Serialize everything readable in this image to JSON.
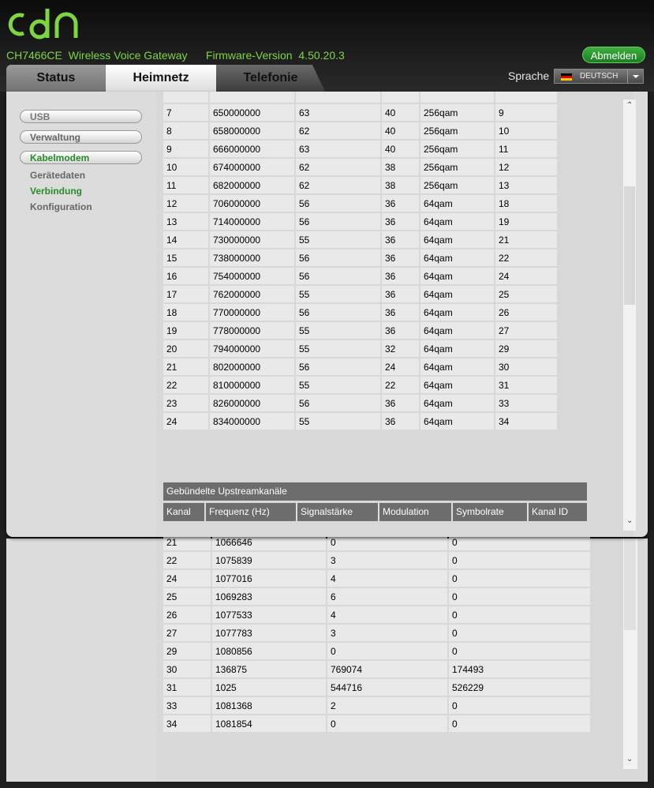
{
  "header": {
    "model": "CH7466CE",
    "device_name": "Wireless Voice Gateway",
    "firmware_label": "Firmware-Version",
    "firmware_version": "4.50.20.3",
    "logout_label": "Abmelden",
    "language_label": "Sprache",
    "language_value": "DEUTSCH"
  },
  "tabs": [
    {
      "label": "Status"
    },
    {
      "label": "Heimnetz"
    },
    {
      "label": "Telefonie"
    }
  ],
  "sidebar": {
    "buttons": [
      {
        "label": "USB"
      },
      {
        "label": "Verwaltung"
      },
      {
        "label": "Kabelmodem"
      }
    ],
    "subitems": [
      {
        "label": "Gerätedaten"
      },
      {
        "label": "Verbindung"
      },
      {
        "label": "Konfiguration"
      }
    ]
  },
  "downstream_rows": [
    [
      "7",
      "650000000",
      "63",
      "40",
      "256qam",
      "9"
    ],
    [
      "8",
      "658000000",
      "62",
      "40",
      "256qam",
      "10"
    ],
    [
      "9",
      "666000000",
      "63",
      "40",
      "256qam",
      "11"
    ],
    [
      "10",
      "674000000",
      "62",
      "38",
      "256qam",
      "12"
    ],
    [
      "11",
      "682000000",
      "62",
      "38",
      "256qam",
      "13"
    ],
    [
      "12",
      "706000000",
      "56",
      "36",
      "64qam",
      "18"
    ],
    [
      "13",
      "714000000",
      "56",
      "36",
      "64qam",
      "19"
    ],
    [
      "14",
      "730000000",
      "55",
      "36",
      "64qam",
      "21"
    ],
    [
      "15",
      "738000000",
      "56",
      "36",
      "64qam",
      "22"
    ],
    [
      "16",
      "754000000",
      "56",
      "36",
      "64qam",
      "24"
    ],
    [
      "17",
      "762000000",
      "55",
      "36",
      "64qam",
      "25"
    ],
    [
      "18",
      "770000000",
      "56",
      "36",
      "64qam",
      "26"
    ],
    [
      "19",
      "778000000",
      "55",
      "36",
      "64qam",
      "27"
    ],
    [
      "20",
      "794000000",
      "55",
      "32",
      "64qam",
      "29"
    ],
    [
      "21",
      "802000000",
      "56",
      "24",
      "64qam",
      "30"
    ],
    [
      "22",
      "810000000",
      "55",
      "22",
      "64qam",
      "31"
    ],
    [
      "23",
      "826000000",
      "56",
      "36",
      "64qam",
      "33"
    ],
    [
      "24",
      "834000000",
      "55",
      "36",
      "64qam",
      "34"
    ]
  ],
  "upstream": {
    "title": "Gebündelte Upstreamkanäle",
    "headers": [
      "Kanal",
      "Frequenz (Hz)",
      "Signalstärke",
      "Modulation",
      "Symbolrate",
      "Kanal ID"
    ]
  },
  "lower_rows": [
    [
      "21",
      "1066646",
      "0",
      "0"
    ],
    [
      "22",
      "1075839",
      "3",
      "0"
    ],
    [
      "24",
      "1077016",
      "4",
      "0"
    ],
    [
      "25",
      "1069283",
      "6",
      "0"
    ],
    [
      "26",
      "1077533",
      "4",
      "0"
    ],
    [
      "27",
      "1077783",
      "3",
      "0"
    ],
    [
      "29",
      "1080856",
      "0",
      "0"
    ],
    [
      "30",
      "136875",
      "769074",
      "174493"
    ],
    [
      "31",
      "1025",
      "544716",
      "526229"
    ],
    [
      "33",
      "1081368",
      "2",
      "0"
    ],
    [
      "34",
      "1081854",
      "0",
      "0"
    ]
  ],
  "colors": {
    "accent_green": "#7dd641",
    "nav_active": "#2a8a2a",
    "nav_inactive": "#666666"
  }
}
